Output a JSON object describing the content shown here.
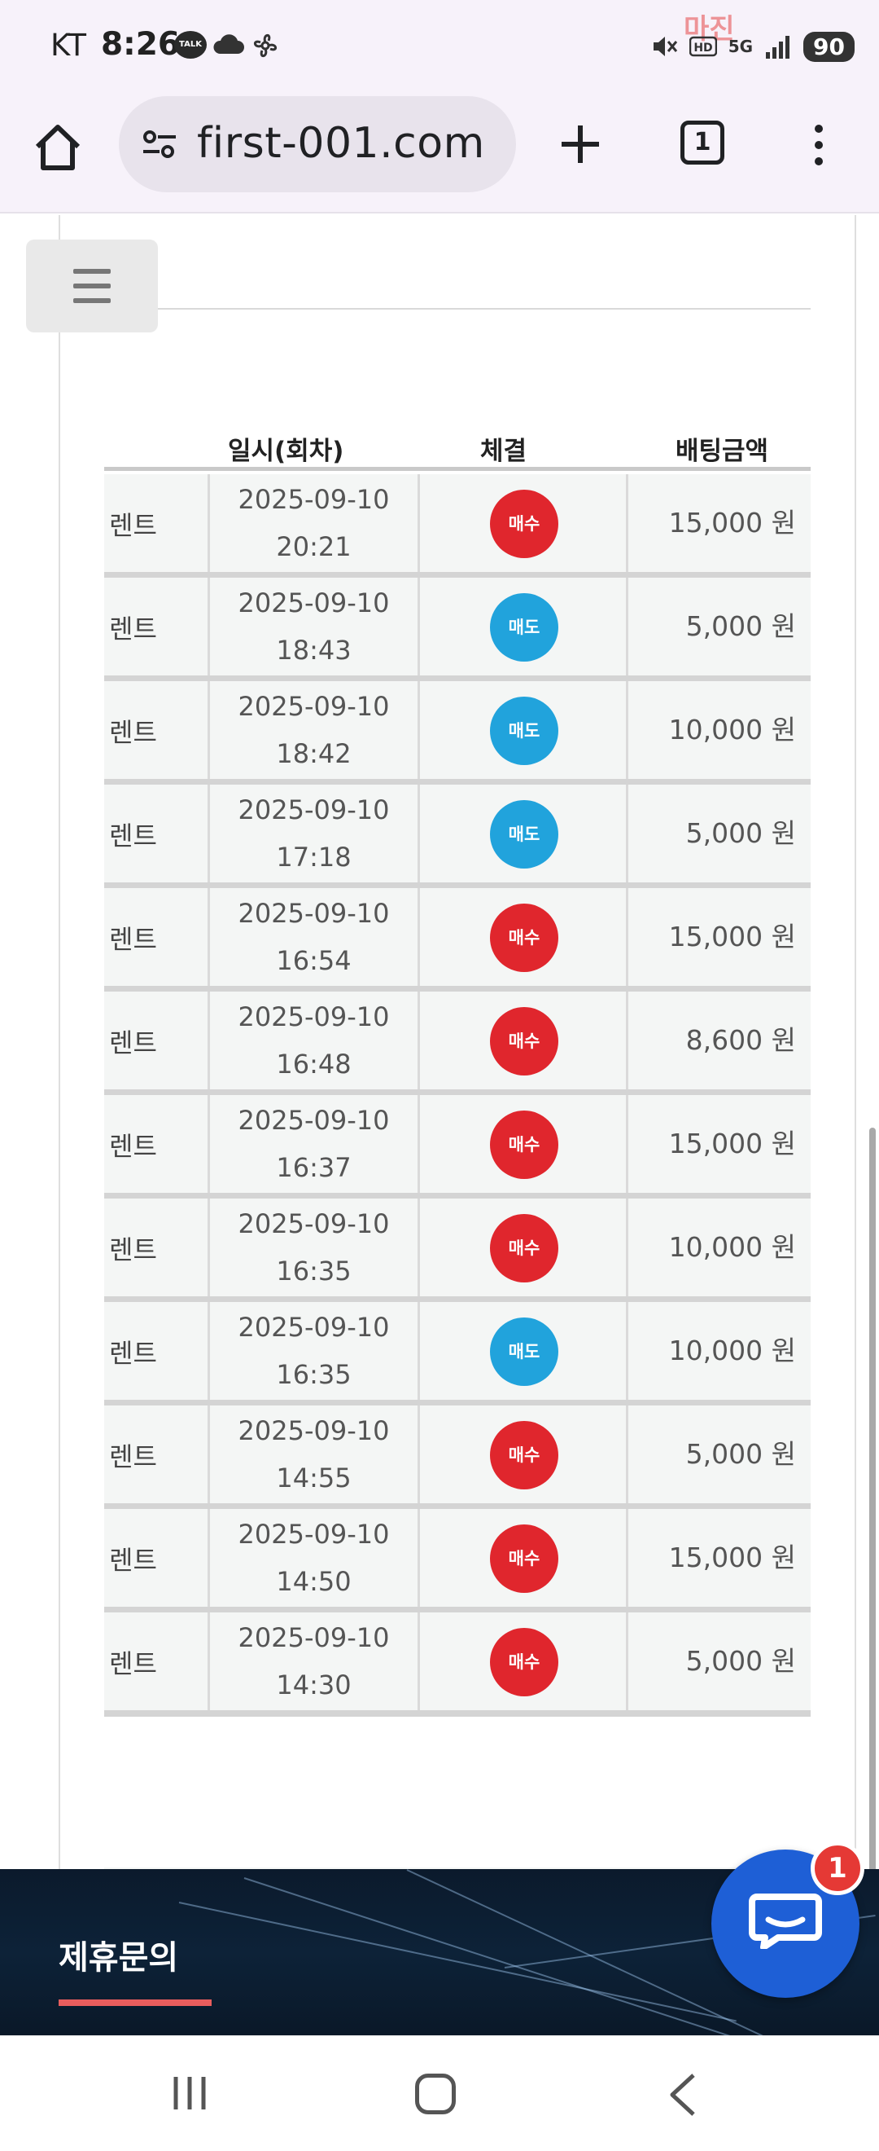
{
  "status_bar": {
    "carrier": "KT",
    "time": "8:26",
    "talk_label": "TALK",
    "network": "5G",
    "battery": "90",
    "watermark": "마진"
  },
  "browser": {
    "url": "first-001.com",
    "tab_count": "1"
  },
  "table": {
    "headers": [
      "일시(회차)",
      "체결",
      "배팅금액"
    ],
    "rows": [
      {
        "game": "렌트",
        "date": "2025-09-10",
        "time": "20:21",
        "type": "매수",
        "amount": "15,000 원"
      },
      {
        "game": "렌트",
        "date": "2025-09-10",
        "time": "18:43",
        "type": "매도",
        "amount": "5,000 원"
      },
      {
        "game": "렌트",
        "date": "2025-09-10",
        "time": "18:42",
        "type": "매도",
        "amount": "10,000 원"
      },
      {
        "game": "렌트",
        "date": "2025-09-10",
        "time": "17:18",
        "type": "매도",
        "amount": "5,000 원"
      },
      {
        "game": "렌트",
        "date": "2025-09-10",
        "time": "16:54",
        "type": "매수",
        "amount": "15,000 원"
      },
      {
        "game": "렌트",
        "date": "2025-09-10",
        "time": "16:48",
        "type": "매수",
        "amount": "8,600 원"
      },
      {
        "game": "렌트",
        "date": "2025-09-10",
        "time": "16:37",
        "type": "매수",
        "amount": "15,000 원"
      },
      {
        "game": "렌트",
        "date": "2025-09-10",
        "time": "16:35",
        "type": "매수",
        "amount": "10,000 원"
      },
      {
        "game": "렌트",
        "date": "2025-09-10",
        "time": "16:35",
        "type": "매도",
        "amount": "10,000 원"
      },
      {
        "game": "렌트",
        "date": "2025-09-10",
        "time": "14:55",
        "type": "매수",
        "amount": "5,000 원"
      },
      {
        "game": "렌트",
        "date": "2025-09-10",
        "time": "14:50",
        "type": "매수",
        "amount": "15,000 원"
      },
      {
        "game": "렌트",
        "date": "2025-09-10",
        "time": "14:30",
        "type": "매수",
        "amount": "5,000 원"
      }
    ],
    "colors": {
      "buy": "#e0262d",
      "sell": "#21a3dc"
    }
  },
  "footer": {
    "title": "제휴문의"
  },
  "chat": {
    "badge": "1"
  }
}
